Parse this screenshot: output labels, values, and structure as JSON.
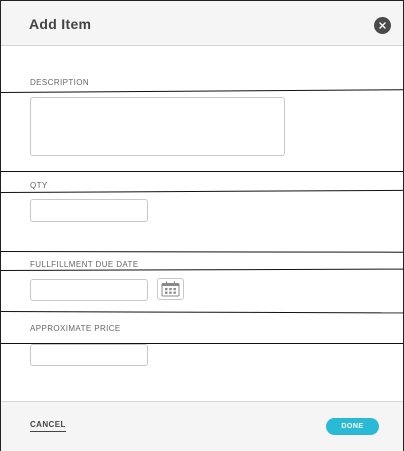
{
  "dialog": {
    "title": "Add Item",
    "close_icon": "close-icon"
  },
  "fields": {
    "description": {
      "label": "DESCRIPTION",
      "value": "",
      "placeholder": ""
    },
    "qty": {
      "label": "QTY",
      "value": "",
      "placeholder": ""
    },
    "due_date": {
      "label": "FULLFILLMENT DUE DATE",
      "value": "",
      "placeholder": "",
      "icon": "calendar-icon"
    },
    "price": {
      "label": "APPROXIMATE PRICE",
      "value": "",
      "placeholder": ""
    }
  },
  "footer": {
    "cancel_label": "CANCEL",
    "done_label": "DONE"
  },
  "colors": {
    "accent": "#2bbad6",
    "header_bg": "#f5f5f5",
    "close_bg": "#4a4a4a"
  }
}
